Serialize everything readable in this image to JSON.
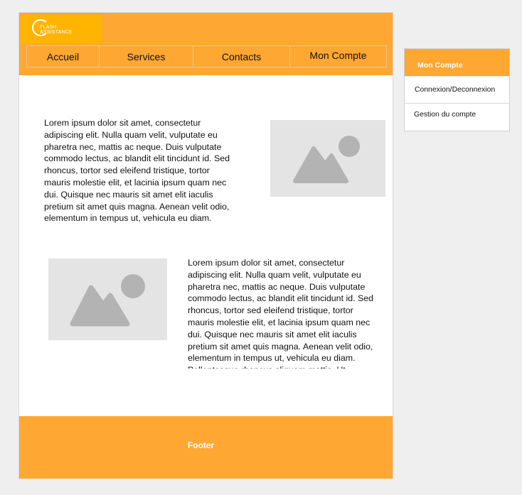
{
  "colors": {
    "brand_orange": "#ffa733",
    "logo_yellow": "#ffb400",
    "placeholder_gray": "#e4e4e4",
    "placeholder_icon": "#b3b3b3",
    "background": "#efefef"
  },
  "header": {
    "logo": {
      "line1": "FLASH",
      "line2": "ASSISTANCE"
    },
    "nav": [
      {
        "label": "Accueil"
      },
      {
        "label": "Services"
      },
      {
        "label": "Contacts"
      },
      {
        "label": "Mon Compte"
      }
    ]
  },
  "main": {
    "block1": {
      "text": "Lorem ipsum dolor sit amet, consectetur\nadipiscing elit. Nulla quam velit, vulputate eu\npharetra nec, mattis ac neque. Duis vulputate\ncommodo lectus, ac blandit elit tincidunt id. Sed\nrhoncus, tortor sed eleifend tristique, tortor\nmauris molestie elit, et lacinia ipsum quam nec\ndui. Quisque nec mauris sit amet elit iaculis\npretium sit amet quis magna. Aenean velit odio,\nelementum in tempus ut, vehicula eu diam.",
      "image_icon": "image-placeholder-icon"
    },
    "block2": {
      "text": "Lorem ipsum dolor sit amet, consectetur\nadipiscing elit. Nulla quam velit, vulputate eu\npharetra nec, mattis ac neque. Duis vulputate\ncommodo lectus, ac blandit elit tincidunt id. Sed\nrhoncus, tortor sed eleifend tristique, tortor\nmauris molestie elit, et lacinia ipsum quam nec\ndui. Quisque nec mauris sit amet elit iaculis\npretium sit amet quis magna. Aenean velit odio,\nelementum in tempus ut, vehicula eu diam.\nPellentesque rhoncus aliquam mattis. Ut",
      "image_icon": "image-placeholder-icon"
    }
  },
  "footer": {
    "label": "Footer"
  },
  "account_panel": {
    "title": "Mon Compte",
    "items": [
      {
        "label": "Connexion/Deconnexion"
      },
      {
        "label": "Gestion du compte"
      }
    ]
  }
}
